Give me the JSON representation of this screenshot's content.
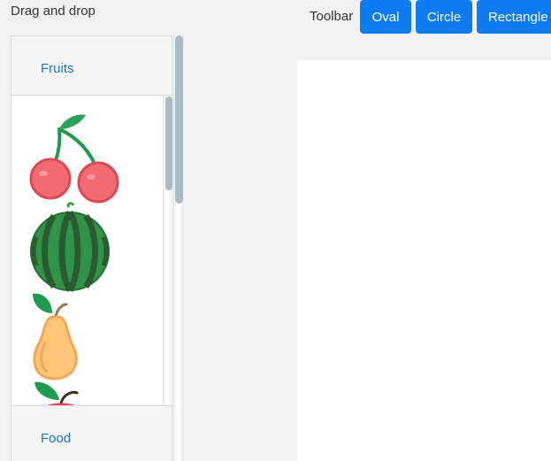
{
  "page": {
    "title": "Drag and drop"
  },
  "toolbar": {
    "label": "Toolbar",
    "buttons": [
      {
        "label": "Oval"
      },
      {
        "label": "Circle"
      },
      {
        "label": "Rectangle"
      }
    ],
    "button_color": "#0d7cf2"
  },
  "palette": {
    "sections": [
      {
        "label": "Fruits",
        "expanded": true
      },
      {
        "label": "Food",
        "expanded": false
      }
    ],
    "fruits": [
      {
        "icon": "cherry-icon"
      },
      {
        "icon": "watermelon-icon"
      },
      {
        "icon": "pear-icon"
      },
      {
        "icon": "apple-icon"
      }
    ],
    "link_color": "#1a73c8"
  }
}
